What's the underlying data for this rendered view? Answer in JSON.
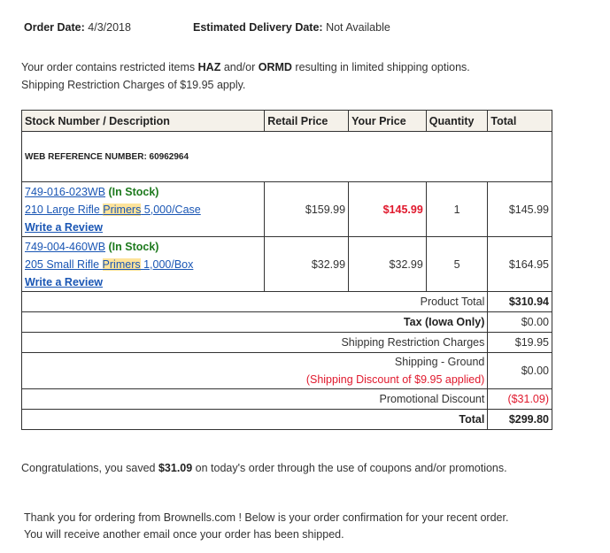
{
  "header": {
    "order_date_label": "Order Date:",
    "order_date": "4/3/2018",
    "delivery_label": "Estimated Delivery Date:",
    "delivery_value": "Not Available"
  },
  "notice": {
    "line1_a": "Your order contains restricted items ",
    "haz": "HAZ",
    "line1_b": " and/or ",
    "ormd": "ORMD",
    "line1_c": " resulting in limited shipping options.",
    "line2": "Shipping Restriction Charges of $19.95 apply."
  },
  "table": {
    "headers": [
      "Stock Number / Description",
      "Retail Price",
      "Your Price",
      "Quantity",
      "Total"
    ],
    "web_reference": "WEB REFERENCE NUMBER: 60962964",
    "items": [
      {
        "stock_number": "749-016-023WB",
        "stock_status": "(In Stock)",
        "desc_pre": "210 Large Rifle ",
        "desc_hl": "Primers",
        "desc_post": " 5,000/Case",
        "review": "Write a Review",
        "retail": "$159.99",
        "your_price": "$145.99",
        "your_price_color": "#e0192d",
        "quantity": "1",
        "total": "$145.99"
      },
      {
        "stock_number": "749-004-460WB",
        "stock_status": "(In Stock)",
        "desc_pre": "205 Small Rifle ",
        "desc_hl": "Primers",
        "desc_post": " 1,000/Box",
        "review": "Write a Review",
        "retail": "$32.99",
        "your_price": "$32.99",
        "your_price_color": "#333333",
        "quantity": "5",
        "total": "$164.95"
      }
    ],
    "summary": {
      "product_total_label": "Product Total",
      "product_total": "$310.94",
      "tax_label": "Tax (Iowa Only)",
      "tax": "$0.00",
      "ship_restrict_label": "Shipping Restriction Charges",
      "ship_restrict": "$19.95",
      "shipping_label": "Shipping - Ground",
      "shipping_discount": "(Shipping Discount of $9.95 applied)",
      "shipping": "$0.00",
      "promo_label": "Promotional Discount",
      "promo": "($31.09)",
      "total_label": "Total",
      "total": "$299.80"
    }
  },
  "congrats": {
    "pre": "Congratulations, you saved ",
    "amount": "$31.09",
    "post": " on today's order through the use of coupons and/or promotions."
  },
  "thanks": {
    "line1": "Thank you for ordering from Brownells.com ! Below is your order confirmation for your recent order.",
    "line2": "You will receive another email once your order has been shipped."
  },
  "colors": {
    "accent_red": "#e0192d",
    "stock_green": "#1e7a1e",
    "link_blue": "#1a56b4",
    "highlight": "#fde39a"
  }
}
